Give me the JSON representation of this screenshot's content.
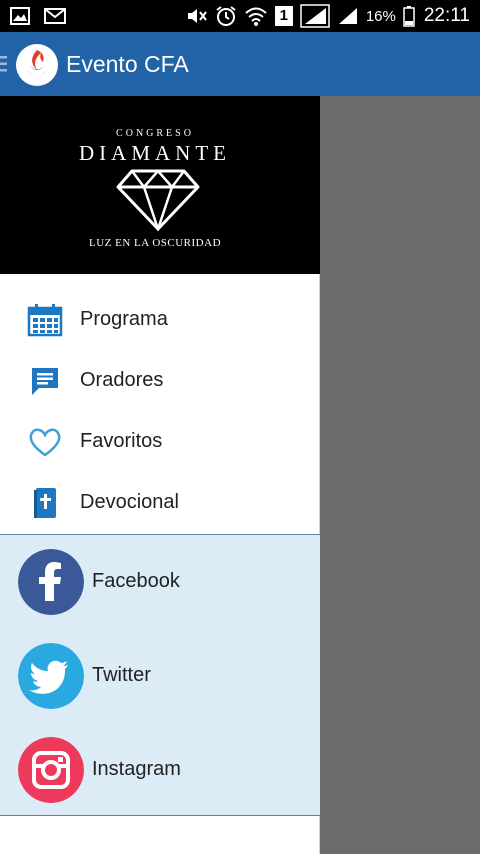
{
  "status_bar": {
    "battery": "16%",
    "time": "22:11",
    "sim_slot": "1",
    "icons": [
      "image-icon",
      "mail-icon",
      "mute-icon",
      "alarm-icon",
      "wifi-icon",
      "signal-icon",
      "battery-icon"
    ]
  },
  "app_bar": {
    "title": "Evento CFA",
    "color": "#2163a6"
  },
  "banner": {
    "small": "CONGRESO",
    "big": "DIAMANTE",
    "tagline": "LUZ EN LA OSCURIDAD"
  },
  "menu": {
    "accent": "#1e77c1",
    "items": [
      {
        "label": "Programa",
        "icon": "calendar-icon"
      },
      {
        "label": "Oradores",
        "icon": "chat-icon"
      },
      {
        "label": "Favoritos",
        "icon": "heart-icon"
      },
      {
        "label": "Devocional",
        "icon": "bible-icon"
      }
    ]
  },
  "social": {
    "background": "#dcecf7",
    "items": [
      {
        "label": "Facebook",
        "icon": "facebook-icon",
        "color": "#3b5998"
      },
      {
        "label": "Twitter",
        "icon": "twitter-icon",
        "color": "#2aa9e0"
      },
      {
        "label": "Instagram",
        "icon": "instagram-icon",
        "color": "#ee3a5a"
      }
    ]
  }
}
